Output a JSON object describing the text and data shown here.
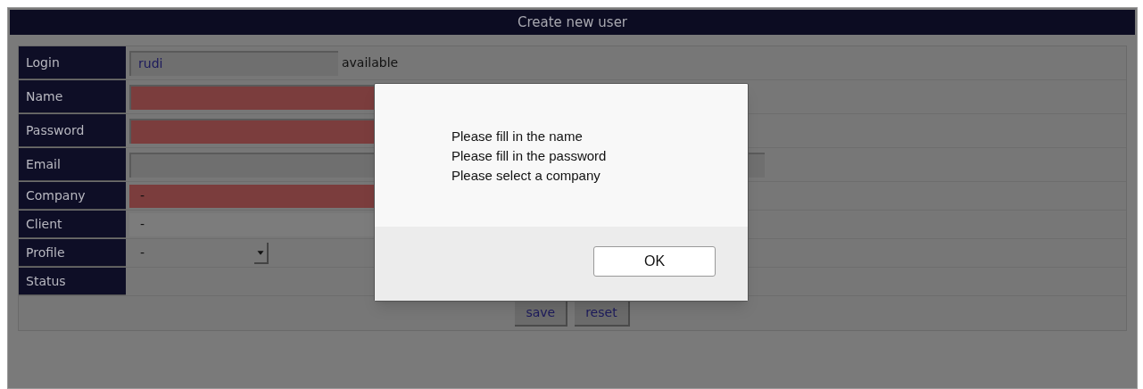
{
  "page": {
    "title": "Create new user"
  },
  "fields": [
    {
      "label": "Login",
      "kind": "short-text",
      "value": "rudi",
      "invalid": false,
      "note": "available"
    },
    {
      "label": "Name",
      "kind": "text",
      "invalid": true
    },
    {
      "label": "Password",
      "kind": "text",
      "invalid": true
    },
    {
      "label": "Email",
      "kind": "wide-text",
      "invalid": false
    },
    {
      "label": "Company",
      "kind": "select",
      "value": "-",
      "invalid": true
    },
    {
      "label": "Client",
      "kind": "select",
      "value": "-",
      "invalid": false
    },
    {
      "label": "Profile",
      "kind": "dropdown",
      "value": "-"
    },
    {
      "label": "Status",
      "kind": "none"
    }
  ],
  "buttons": [
    "save",
    "reset"
  ],
  "dialog": {
    "messages": [
      "Please fill in the name",
      "Please fill in the password",
      "Please select a company"
    ],
    "button": "OK"
  }
}
